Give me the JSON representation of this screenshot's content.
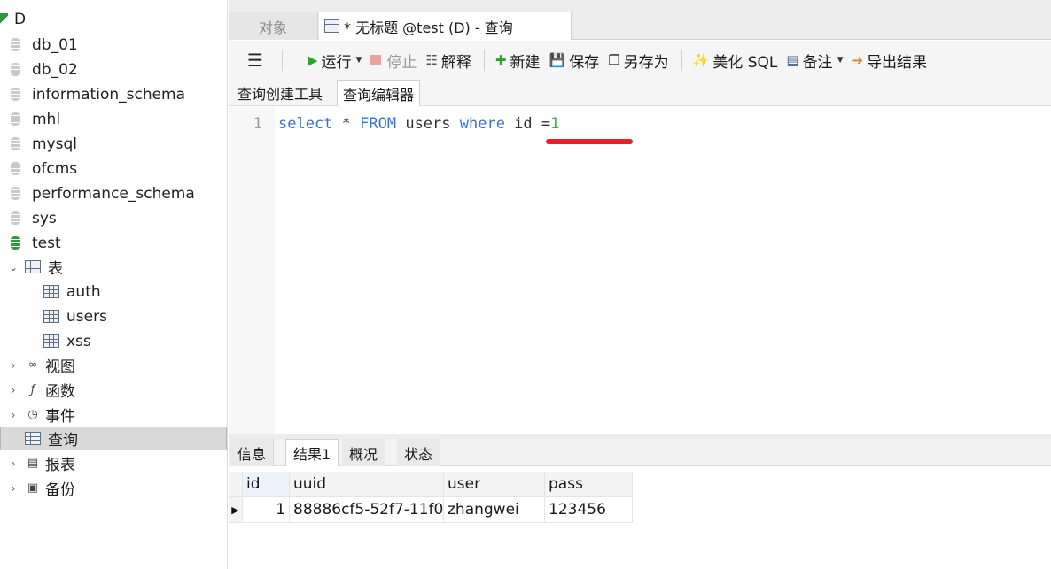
{
  "sidebar": {
    "connection": "D",
    "databases": [
      "db_01",
      "db_02",
      "information_schema",
      "mhl",
      "mysql",
      "ofcms",
      "performance_schema",
      "sys",
      "test"
    ],
    "tables_folder": "表",
    "tables": [
      "auth",
      "users",
      "xss"
    ],
    "views": "视图",
    "functions": "函数",
    "events": "事件",
    "queries": "查询",
    "reports": "报表",
    "backups": "备份"
  },
  "tabs": {
    "objects": "对象",
    "query_tab": "* 无标题 @test (D) - 查询"
  },
  "toolbar": {
    "run": "运行",
    "stop": "停止",
    "explain": "解释",
    "new": "新建",
    "save": "保存",
    "save_as": "另存为",
    "beautify": "美化 SQL",
    "comment": "备注",
    "export": "导出结果"
  },
  "subtabs": {
    "builder": "查询创建工具",
    "editor": "查询编辑器"
  },
  "editor": {
    "line_number": "1",
    "tokens": {
      "select": "select",
      "star": " * ",
      "from": "FROM",
      "table": " users ",
      "where": "where",
      "cond": " id =",
      "value": "1"
    }
  },
  "results": {
    "tabs": [
      "信息",
      "结果1",
      "概况",
      "状态"
    ],
    "active_tab": "结果1",
    "columns": [
      "id",
      "uuid",
      "user",
      "pass"
    ],
    "rows": [
      [
        "1",
        "88886cf5-52f7-11f0-",
        "zhangwei",
        "123456"
      ]
    ]
  },
  "colors": {
    "keyword": "#3d72c9",
    "number": "#3fa64a",
    "annotation_underline": "#e8202a"
  }
}
